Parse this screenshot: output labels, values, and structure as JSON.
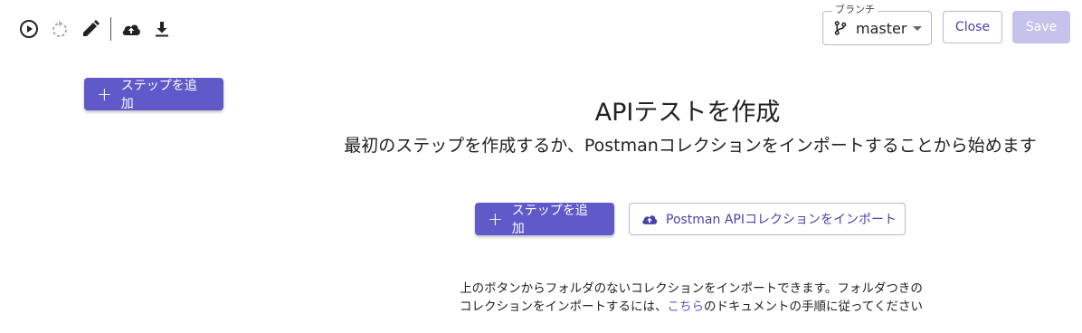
{
  "toolbar": {
    "icons": [
      "run-icon",
      "reload-icon",
      "edit-icon",
      "cloud-upload-icon",
      "download-icon"
    ]
  },
  "branch": {
    "legend": "ブランチ",
    "value": "master"
  },
  "header_buttons": {
    "close": "Close",
    "save": "Save"
  },
  "sidebar": {
    "add_step": "ステップを追加"
  },
  "main": {
    "title": "APIテストを作成",
    "subtitle": "最初のステップを作成するか、Postmanコレクションをインポートすることから始めます",
    "add_step": "ステップを追加",
    "import_postman": "Postman APIコレクションをインポート",
    "note_line1": "上のボタンからフォルダのないコレクションをインポートできます。フォルダつきの",
    "note_line2_prefix": "コレクションをインポートするには、",
    "note_link": "こちら",
    "note_line2_suffix": "のドキュメントの手順に従ってください"
  },
  "colors": {
    "accent": "#5f59c9",
    "accent_text": "#4a43a6",
    "disabled": "#c5c3ec"
  }
}
